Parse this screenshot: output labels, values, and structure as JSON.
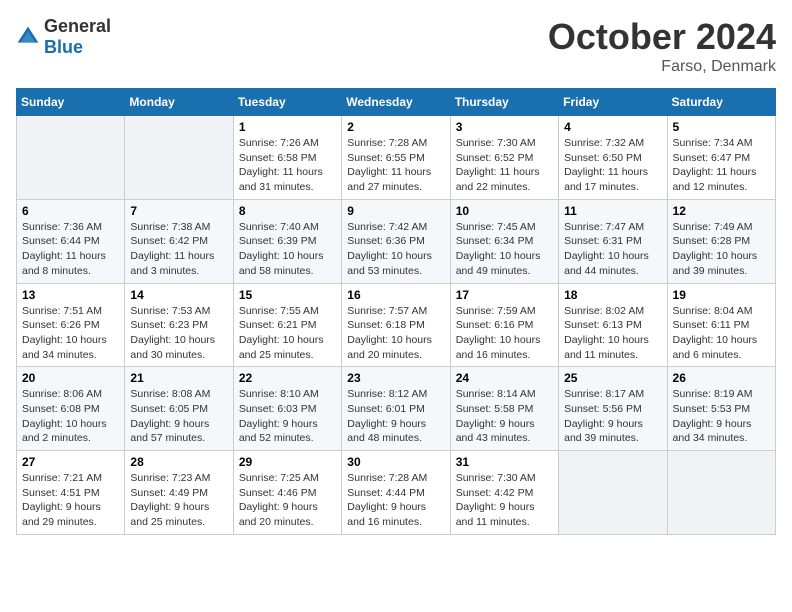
{
  "header": {
    "logo_general": "General",
    "logo_blue": "Blue",
    "month": "October 2024",
    "location": "Farso, Denmark"
  },
  "weekdays": [
    "Sunday",
    "Monday",
    "Tuesday",
    "Wednesday",
    "Thursday",
    "Friday",
    "Saturday"
  ],
  "weeks": [
    [
      {
        "day": "",
        "info": ""
      },
      {
        "day": "",
        "info": ""
      },
      {
        "day": "1",
        "info": "Sunrise: 7:26 AM\nSunset: 6:58 PM\nDaylight: 11 hours and 31 minutes."
      },
      {
        "day": "2",
        "info": "Sunrise: 7:28 AM\nSunset: 6:55 PM\nDaylight: 11 hours and 27 minutes."
      },
      {
        "day": "3",
        "info": "Sunrise: 7:30 AM\nSunset: 6:52 PM\nDaylight: 11 hours and 22 minutes."
      },
      {
        "day": "4",
        "info": "Sunrise: 7:32 AM\nSunset: 6:50 PM\nDaylight: 11 hours and 17 minutes."
      },
      {
        "day": "5",
        "info": "Sunrise: 7:34 AM\nSunset: 6:47 PM\nDaylight: 11 hours and 12 minutes."
      }
    ],
    [
      {
        "day": "6",
        "info": "Sunrise: 7:36 AM\nSunset: 6:44 PM\nDaylight: 11 hours and 8 minutes."
      },
      {
        "day": "7",
        "info": "Sunrise: 7:38 AM\nSunset: 6:42 PM\nDaylight: 11 hours and 3 minutes."
      },
      {
        "day": "8",
        "info": "Sunrise: 7:40 AM\nSunset: 6:39 PM\nDaylight: 10 hours and 58 minutes."
      },
      {
        "day": "9",
        "info": "Sunrise: 7:42 AM\nSunset: 6:36 PM\nDaylight: 10 hours and 53 minutes."
      },
      {
        "day": "10",
        "info": "Sunrise: 7:45 AM\nSunset: 6:34 PM\nDaylight: 10 hours and 49 minutes."
      },
      {
        "day": "11",
        "info": "Sunrise: 7:47 AM\nSunset: 6:31 PM\nDaylight: 10 hours and 44 minutes."
      },
      {
        "day": "12",
        "info": "Sunrise: 7:49 AM\nSunset: 6:28 PM\nDaylight: 10 hours and 39 minutes."
      }
    ],
    [
      {
        "day": "13",
        "info": "Sunrise: 7:51 AM\nSunset: 6:26 PM\nDaylight: 10 hours and 34 minutes."
      },
      {
        "day": "14",
        "info": "Sunrise: 7:53 AM\nSunset: 6:23 PM\nDaylight: 10 hours and 30 minutes."
      },
      {
        "day": "15",
        "info": "Sunrise: 7:55 AM\nSunset: 6:21 PM\nDaylight: 10 hours and 25 minutes."
      },
      {
        "day": "16",
        "info": "Sunrise: 7:57 AM\nSunset: 6:18 PM\nDaylight: 10 hours and 20 minutes."
      },
      {
        "day": "17",
        "info": "Sunrise: 7:59 AM\nSunset: 6:16 PM\nDaylight: 10 hours and 16 minutes."
      },
      {
        "day": "18",
        "info": "Sunrise: 8:02 AM\nSunset: 6:13 PM\nDaylight: 10 hours and 11 minutes."
      },
      {
        "day": "19",
        "info": "Sunrise: 8:04 AM\nSunset: 6:11 PM\nDaylight: 10 hours and 6 minutes."
      }
    ],
    [
      {
        "day": "20",
        "info": "Sunrise: 8:06 AM\nSunset: 6:08 PM\nDaylight: 10 hours and 2 minutes."
      },
      {
        "day": "21",
        "info": "Sunrise: 8:08 AM\nSunset: 6:05 PM\nDaylight: 9 hours and 57 minutes."
      },
      {
        "day": "22",
        "info": "Sunrise: 8:10 AM\nSunset: 6:03 PM\nDaylight: 9 hours and 52 minutes."
      },
      {
        "day": "23",
        "info": "Sunrise: 8:12 AM\nSunset: 6:01 PM\nDaylight: 9 hours and 48 minutes."
      },
      {
        "day": "24",
        "info": "Sunrise: 8:14 AM\nSunset: 5:58 PM\nDaylight: 9 hours and 43 minutes."
      },
      {
        "day": "25",
        "info": "Sunrise: 8:17 AM\nSunset: 5:56 PM\nDaylight: 9 hours and 39 minutes."
      },
      {
        "day": "26",
        "info": "Sunrise: 8:19 AM\nSunset: 5:53 PM\nDaylight: 9 hours and 34 minutes."
      }
    ],
    [
      {
        "day": "27",
        "info": "Sunrise: 7:21 AM\nSunset: 4:51 PM\nDaylight: 9 hours and 29 minutes."
      },
      {
        "day": "28",
        "info": "Sunrise: 7:23 AM\nSunset: 4:49 PM\nDaylight: 9 hours and 25 minutes."
      },
      {
        "day": "29",
        "info": "Sunrise: 7:25 AM\nSunset: 4:46 PM\nDaylight: 9 hours and 20 minutes."
      },
      {
        "day": "30",
        "info": "Sunrise: 7:28 AM\nSunset: 4:44 PM\nDaylight: 9 hours and 16 minutes."
      },
      {
        "day": "31",
        "info": "Sunrise: 7:30 AM\nSunset: 4:42 PM\nDaylight: 9 hours and 11 minutes."
      },
      {
        "day": "",
        "info": ""
      },
      {
        "day": "",
        "info": ""
      }
    ]
  ]
}
